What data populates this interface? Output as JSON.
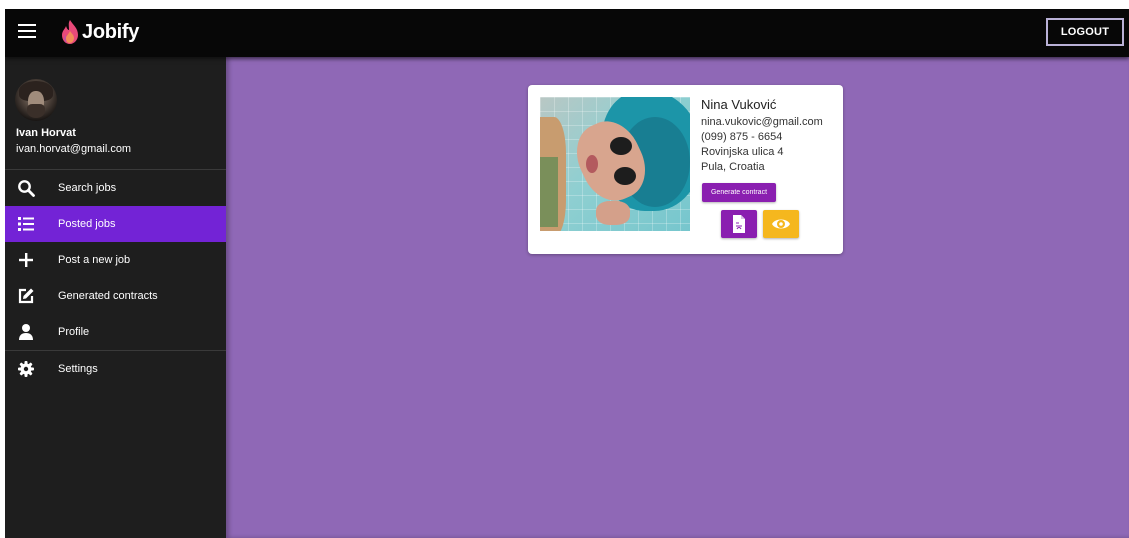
{
  "app": {
    "name": "Jobify",
    "logout_label": "LOGOUT"
  },
  "icons": {
    "menu": "hamburger-icon",
    "logo": "flame-icon",
    "search": "search-icon",
    "posted": "list-icon",
    "post_new": "plus-icon",
    "contracts": "edit-icon",
    "profile": "user-icon",
    "settings": "gear-icon",
    "document": "pdf-document-icon",
    "view": "eye-icon"
  },
  "colors": {
    "topbar": "#070707",
    "sidebar": "#1e1e1e",
    "active_item": "#7323d6",
    "main_background": "#8f68b6",
    "contract_button": "#8a1fb0",
    "view_button": "#f5b71e"
  },
  "sidebar": {
    "user_name": "Ivan Horvat",
    "user_email": "ivan.horvat@gmail.com",
    "items": [
      {
        "label": "Search jobs",
        "active": false
      },
      {
        "label": "Posted jobs",
        "active": true
      },
      {
        "label": "Post a new job",
        "active": false
      },
      {
        "label": "Generated contracts",
        "active": false
      },
      {
        "label": "Profile",
        "active": false
      },
      {
        "label": "Settings",
        "active": false
      }
    ]
  },
  "candidate": {
    "name": "Nina Vuković",
    "email": "nina.vukovic@gmail.com",
    "phone": "(099) 875 - 6654",
    "street": "Rovinjska ulica 4",
    "city": "Pula, Croatia",
    "generate_label": "Generate contract"
  }
}
